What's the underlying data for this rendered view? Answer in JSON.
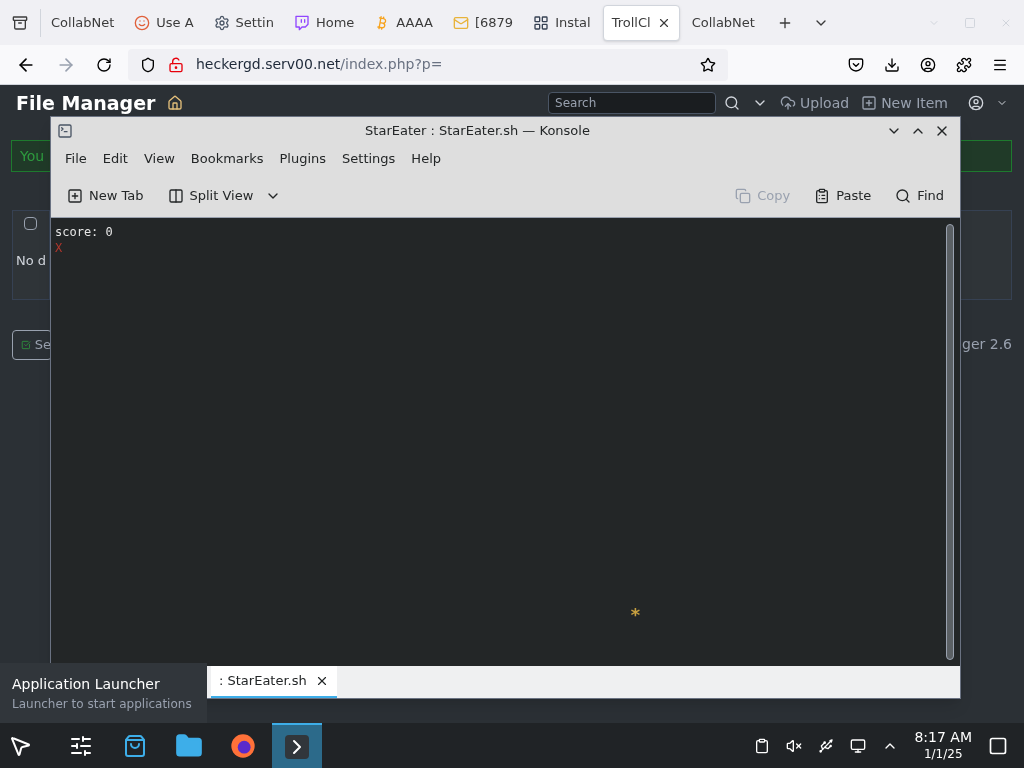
{
  "browser": {
    "tabs": [
      {
        "label": "CollabNet",
        "kind": "plain",
        "selected": false
      },
      {
        "label": "Use A",
        "kind": "face",
        "selected": false
      },
      {
        "label": "Settin",
        "kind": "gear",
        "selected": false
      },
      {
        "label": "Home",
        "kind": "stream",
        "selected": false
      },
      {
        "label": "AAAA",
        "kind": "coin",
        "selected": false
      },
      {
        "label": "[6879",
        "kind": "mail",
        "selected": false
      },
      {
        "label": "Instal",
        "kind": "apps",
        "selected": false
      },
      {
        "label": "TrollCl",
        "kind": "plain",
        "selected": true
      },
      {
        "label": "CollabNet",
        "kind": "plain",
        "selected": false
      }
    ],
    "url_host": "heckergd.serv00.net",
    "url_path": "/index.php?p="
  },
  "page": {
    "title": "File Manager",
    "search_placeholder": "Search",
    "actions": [
      {
        "label": "Upload",
        "kind": "upload"
      },
      {
        "label": "New Item",
        "kind": "new"
      }
    ],
    "alert": "You",
    "header_checked": false,
    "empty_text": "No d",
    "select_button": "Se",
    "footer": "ger 2.6"
  },
  "konsole": {
    "title": "StarEater : StarEater.sh — Konsole",
    "menu": [
      "File",
      "Edit",
      "View",
      "Bookmarks",
      "Plugins",
      "Settings",
      "Help"
    ],
    "toolbar_left": [
      {
        "label": "New Tab",
        "kind": "newtab"
      },
      {
        "label": "Split View",
        "kind": "split"
      }
    ],
    "toolbar_right": [
      {
        "label": "Copy",
        "kind": "copy",
        "disabled": true
      },
      {
        "label": "Paste",
        "kind": "paste",
        "disabled": false
      },
      {
        "label": "Find",
        "kind": "find",
        "disabled": false
      }
    ],
    "lines": [
      {
        "text": "score: 0",
        "color": "#e6e6e6"
      },
      {
        "text": "X",
        "color": "#b0362c"
      }
    ],
    "star": {
      "text": "*",
      "color": "#c8a040"
    },
    "tab": ": StarEater.sh"
  },
  "tooltip": {
    "title": "Application Launcher",
    "subtitle": "Launcher to start applications"
  },
  "taskbar": {
    "apps": [
      {
        "kind": "settings",
        "selected": false
      },
      {
        "kind": "store",
        "selected": false
      },
      {
        "kind": "folder",
        "selected": false
      },
      {
        "kind": "firefox",
        "selected": false
      },
      {
        "kind": "terminal",
        "selected": true
      }
    ],
    "time": "8:17 AM",
    "date": "1/1/25"
  }
}
